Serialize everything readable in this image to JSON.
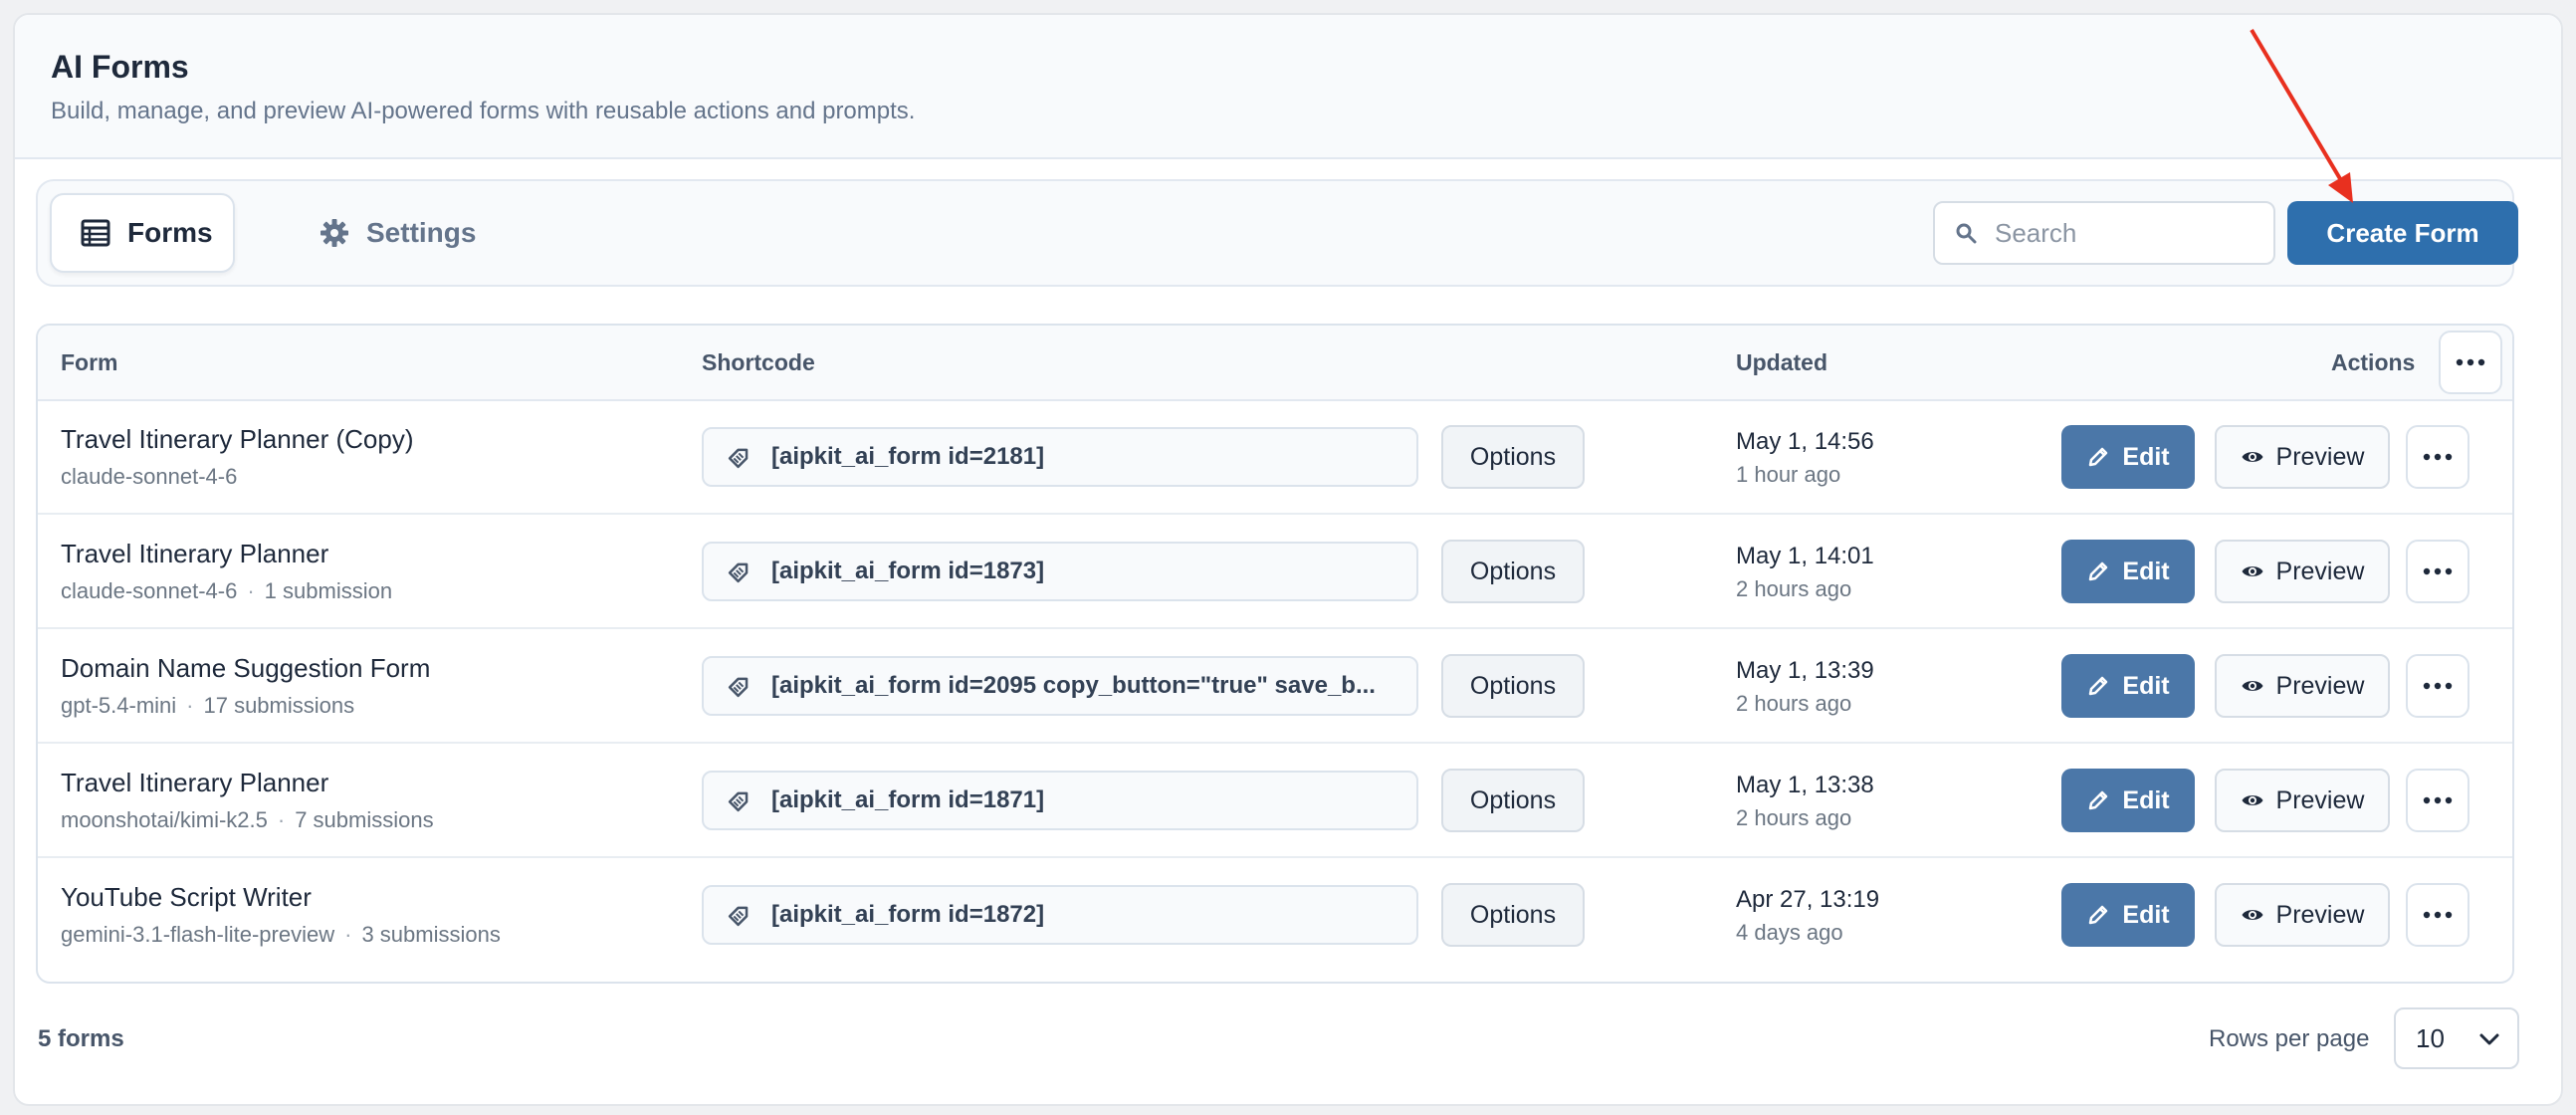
{
  "header": {
    "title": "AI Forms",
    "subtitle": "Build, manage, and preview AI-powered forms with reusable actions and prompts."
  },
  "tabs": [
    {
      "label": "Forms",
      "icon": "table-list-icon",
      "active": true
    },
    {
      "label": "Settings",
      "icon": "gear-icon",
      "active": false
    }
  ],
  "search": {
    "placeholder": "Search",
    "value": ""
  },
  "create_button": {
    "label": "Create Form"
  },
  "table": {
    "columns": {
      "form": "Form",
      "shortcode": "Shortcode",
      "updated": "Updated",
      "actions": "Actions"
    },
    "rows": [
      {
        "name": "Travel Itinerary Planner (Copy)",
        "model": "claude-sonnet-4-6",
        "submissions": "",
        "shortcode": "[aipkit_ai_form id=2181]",
        "updated_date": "May 1, 14:56",
        "updated_relative": "1 hour ago"
      },
      {
        "name": "Travel Itinerary Planner",
        "model": "claude-sonnet-4-6",
        "submissions": "1 submission",
        "shortcode": "[aipkit_ai_form id=1873]",
        "updated_date": "May 1, 14:01",
        "updated_relative": "2 hours ago"
      },
      {
        "name": "Domain Name Suggestion Form",
        "model": "gpt-5.4-mini",
        "submissions": "17 submissions",
        "shortcode": "[aipkit_ai_form id=2095 copy_button=\"true\" save_b...",
        "updated_date": "May 1, 13:39",
        "updated_relative": "2 hours ago"
      },
      {
        "name": "Travel Itinerary Planner",
        "model": "moonshotai/kimi-k2.5",
        "submissions": "7 submissions",
        "shortcode": "[aipkit_ai_form id=1871]",
        "updated_date": "May 1, 13:38",
        "updated_relative": "2 hours ago"
      },
      {
        "name": "YouTube Script Writer",
        "model": "gemini-3.1-flash-lite-preview",
        "submissions": "3 submissions",
        "shortcode": "[aipkit_ai_form id=1872]",
        "updated_date": "Apr 27, 13:19",
        "updated_relative": "4 days ago"
      }
    ],
    "row_buttons": {
      "options": "Options",
      "edit": "Edit",
      "preview": "Preview"
    }
  },
  "footer": {
    "count": "5 forms",
    "rows_per_page_label": "Rows per page",
    "rows_per_page_value": "10"
  },
  "colors": {
    "primary": "#2e6fad",
    "edit_button": "#4b77a8",
    "annotation_arrow": "#e8301f"
  }
}
